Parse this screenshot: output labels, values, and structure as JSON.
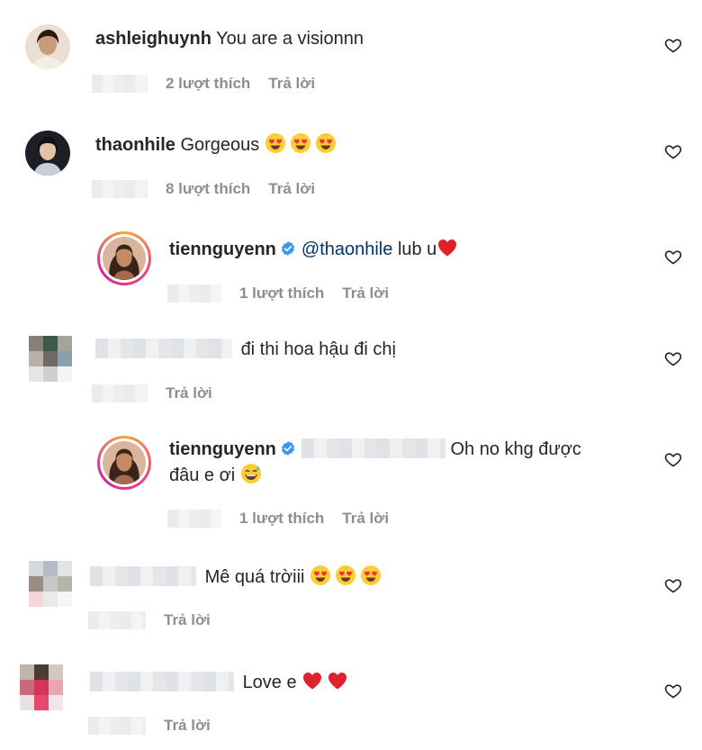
{
  "comments": [
    {
      "username": "ashleighuynh",
      "text": "You are a visionnn",
      "likes": "2 lượt thích",
      "reply": "Trả lời"
    },
    {
      "username": "thaonhile",
      "text": "Gorgeous",
      "likes": "8 lượt thích",
      "reply": "Trả lời"
    },
    {
      "username": "tiennguyenn",
      "mention": "@thaonhile",
      "text": "lub u",
      "likes": "1 lượt thích",
      "reply": "Trả lời"
    },
    {
      "text": "đi thi hoa hậu đi chị",
      "reply": "Trả lời"
    },
    {
      "username": "tiennguyenn",
      "text_line1": "Oh no khg được",
      "text_line2": "đâu e ơi",
      "likes": "1 lượt thích",
      "reply": "Trả lời"
    },
    {
      "text": "Mê quá trờiii",
      "reply": "Trả lời"
    },
    {
      "text": "Love e",
      "reply": "Trả lời"
    }
  ],
  "icons": {
    "like": "heart-outline-icon",
    "verified": "verified-badge-icon",
    "emoji_heart_eyes": "heart-eyes-emoji",
    "emoji_red_heart": "red-heart-emoji",
    "emoji_grin_sweat": "grinning-sweat-emoji"
  },
  "colors": {
    "text": "#262626",
    "secondary": "#8e8e8e",
    "mention": "#00376b",
    "verified": "#3897f0",
    "heart": "#ed2b2b"
  }
}
